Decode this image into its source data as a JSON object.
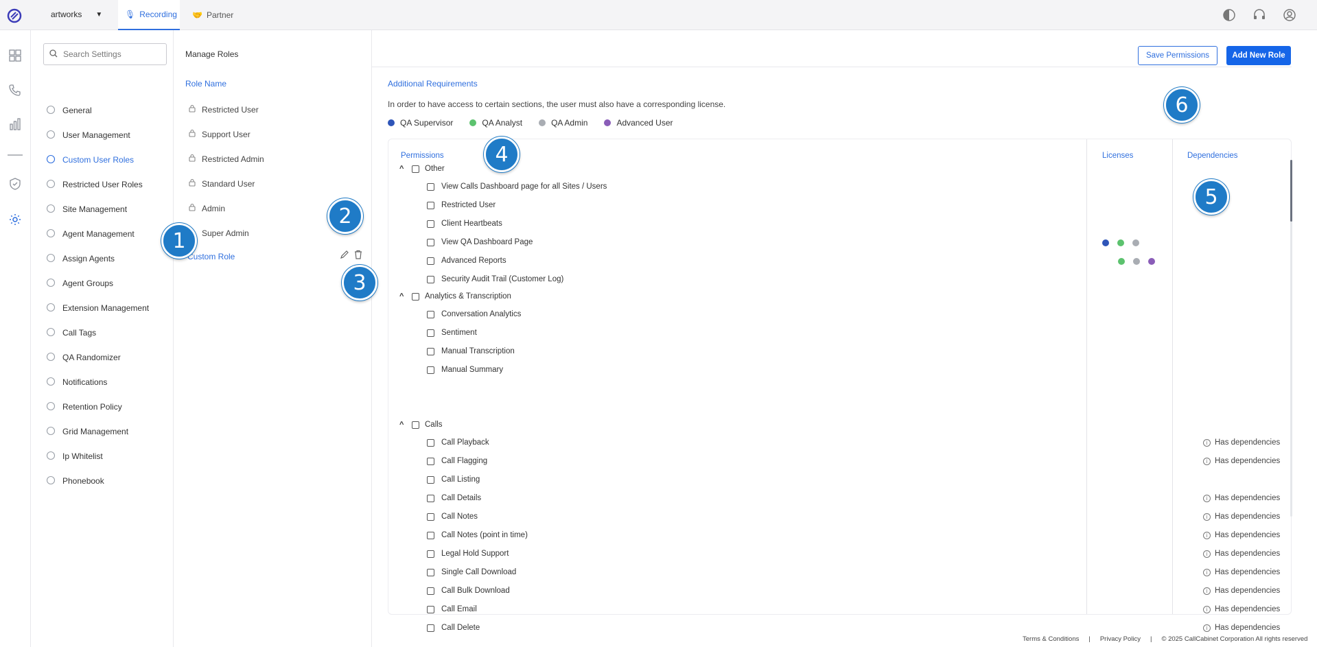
{
  "topbar": {
    "workspace": "artworks",
    "tabs": [
      {
        "label": "Recording"
      },
      {
        "label": "Partner"
      }
    ]
  },
  "search": {
    "placeholder": "Search Settings"
  },
  "settings_nav": [
    {
      "label": "General"
    },
    {
      "label": "User Management"
    },
    {
      "label": "Custom User Roles"
    },
    {
      "label": "Restricted User Roles"
    },
    {
      "label": "Site Management"
    },
    {
      "label": "Agent Management"
    },
    {
      "label": "Assign Agents"
    },
    {
      "label": "Agent Groups"
    },
    {
      "label": "Extension Management"
    },
    {
      "label": "Call Tags"
    },
    {
      "label": "QA Randomizer"
    },
    {
      "label": "Notifications"
    },
    {
      "label": "Retention Policy"
    },
    {
      "label": "Grid Management"
    },
    {
      "label": "Ip Whitelist"
    },
    {
      "label": "Phonebook"
    }
  ],
  "roles": {
    "title": "Manage Roles",
    "header": "Role Name",
    "items": [
      {
        "label": "Restricted User"
      },
      {
        "label": "Support User"
      },
      {
        "label": "Restricted Admin"
      },
      {
        "label": "Standard User"
      },
      {
        "label": "Admin"
      },
      {
        "label": "Super Admin"
      }
    ],
    "custom": "Custom Role"
  },
  "actions": {
    "save": "Save Permissions",
    "add": "Add New Role"
  },
  "requirements": {
    "title": "Additional Requirements",
    "note": "In order to have access to certain sections, the user must also have a corresponding license.",
    "licenses": [
      {
        "label": "QA Supervisor",
        "color": "#2e55b8"
      },
      {
        "label": "QA Analyst",
        "color": "#5cc26e"
      },
      {
        "label": "QA Admin",
        "color": "#a9adb3"
      },
      {
        "label": "Advanced User",
        "color": "#8a5db8"
      }
    ]
  },
  "table": {
    "headers": {
      "permissions": "Permissions",
      "licenses": "Licenses",
      "dependencies": "Dependencies"
    },
    "dep_label": "Has dependencies",
    "groups": [
      {
        "label": "Other",
        "items": [
          "View Calls Dashboard page for all Sites / Users",
          "Restricted User",
          "Client Heartbeats",
          "View QA Dashboard Page",
          "Advanced Reports",
          "Security Audit Trail (Customer Log)"
        ]
      },
      {
        "label": "Analytics & Transcription",
        "items": [
          "Conversation Analytics",
          "Sentiment",
          "Manual Transcription",
          "Manual Summary"
        ]
      },
      {
        "label": "Calls",
        "items": [
          "Call Playback",
          "Call Flagging",
          "Call Listing",
          "Call Details",
          "Call Notes",
          "Call Notes (point in time)",
          "Legal Hold Support",
          "Single Call Download",
          "Call Bulk Download",
          "Call Email",
          "Call Delete"
        ]
      }
    ]
  },
  "footer": {
    "terms": "Terms & Conditions",
    "sep": "|",
    "privacy": "Privacy Policy",
    "copyright": "© 2025 CallCabinet Corporation All rights reserved"
  },
  "callouts": [
    "1",
    "2",
    "3",
    "4",
    "5",
    "6"
  ]
}
